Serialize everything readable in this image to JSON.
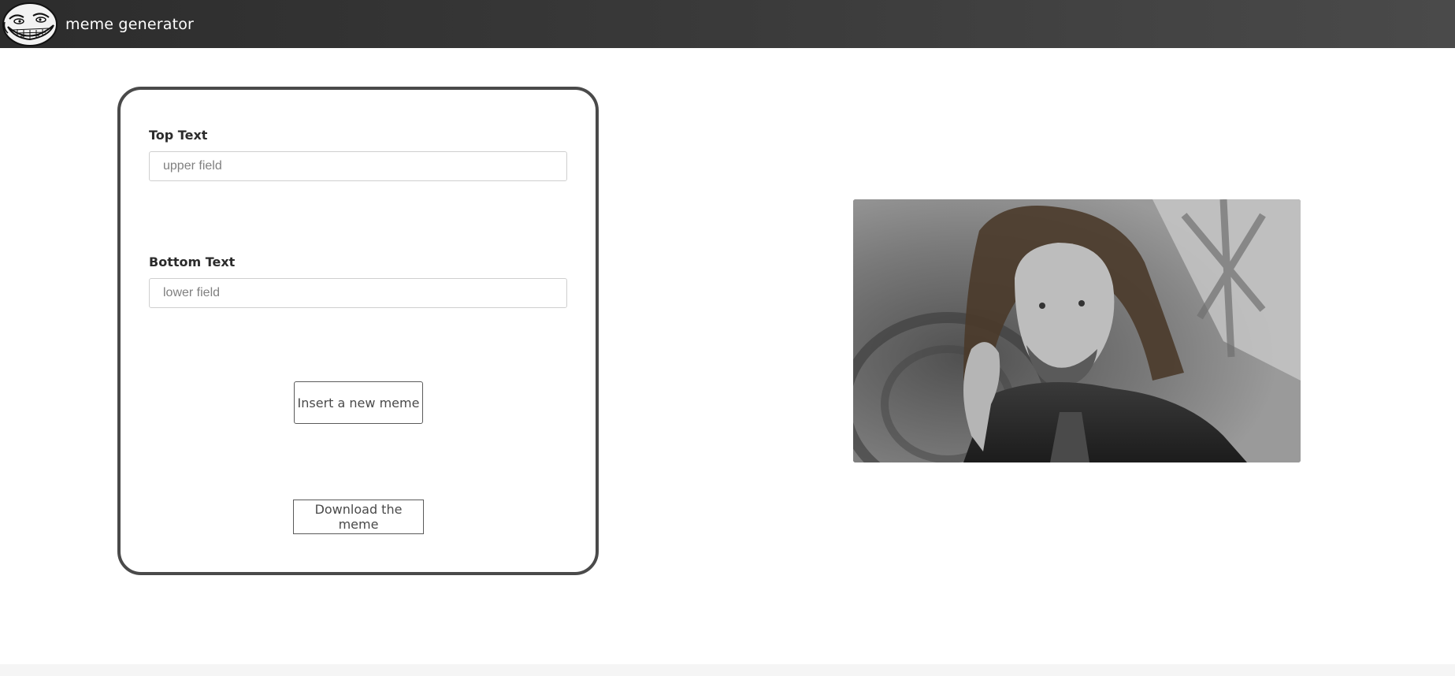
{
  "navbar": {
    "logo_icon": "trollface-icon",
    "brand": "meme generator",
    "background": "#3a3a3a"
  },
  "form": {
    "top_label": "Top Text",
    "top_placeholder": "upper field",
    "top_value": "",
    "bottom_label": "Bottom Text",
    "bottom_placeholder": "lower field",
    "bottom_value": "",
    "insert_button": "Insert a new meme",
    "download_button": "Download the meme"
  },
  "meme": {
    "image_icon": "meme-image",
    "top_caption": "",
    "bottom_caption": ""
  }
}
